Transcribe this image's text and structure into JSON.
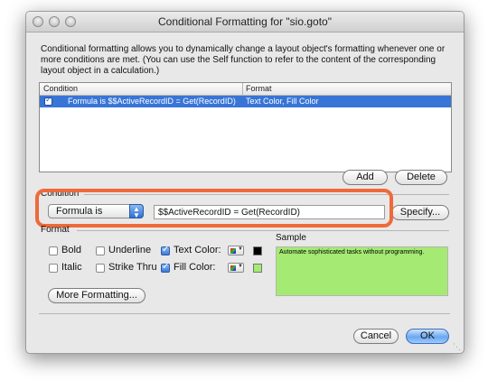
{
  "window": {
    "title": "Conditional Formatting for \"sio.goto\""
  },
  "description": "Conditional formatting allows you to dynamically change a layout object's formatting whenever one or more conditions are met.  (You can use the Self function to refer to the content of the corresponding layout object in a calculation.)",
  "table": {
    "columns": [
      "Condition",
      "Format"
    ],
    "rows": [
      {
        "condition": "Formula is $$ActiveRecordID = Get(RecordID)",
        "format": "Text Color, Fill Color",
        "checked": true,
        "selected": true
      }
    ]
  },
  "buttons": {
    "add": "Add",
    "delete": "Delete",
    "specify": "Specify...",
    "more_formatting": "More Formatting...",
    "cancel": "Cancel",
    "ok": "OK"
  },
  "condition": {
    "section_label": "Condition",
    "type_selected": "Formula is",
    "formula": "$$ActiveRecordID = Get(RecordID)"
  },
  "format": {
    "section_label": "Format",
    "options": {
      "bold": {
        "label": "Bold",
        "checked": false
      },
      "italic": {
        "label": "Italic",
        "checked": false
      },
      "underline": {
        "label": "Underline",
        "checked": false
      },
      "strikethru": {
        "label": "Strike Thru",
        "checked": false
      },
      "text_color": {
        "label": "Text Color:",
        "checked": true,
        "color": "#000000"
      },
      "fill_color": {
        "label": "Fill Color:",
        "checked": true,
        "color": "#a5ea73"
      }
    },
    "sample_label": "Sample",
    "sample_text": "Automate sophisticated tasks without programming."
  },
  "colors": {
    "highlight": "#ef6a3a",
    "selection": "#3875d7",
    "sample_fill": "#a5ea73"
  }
}
